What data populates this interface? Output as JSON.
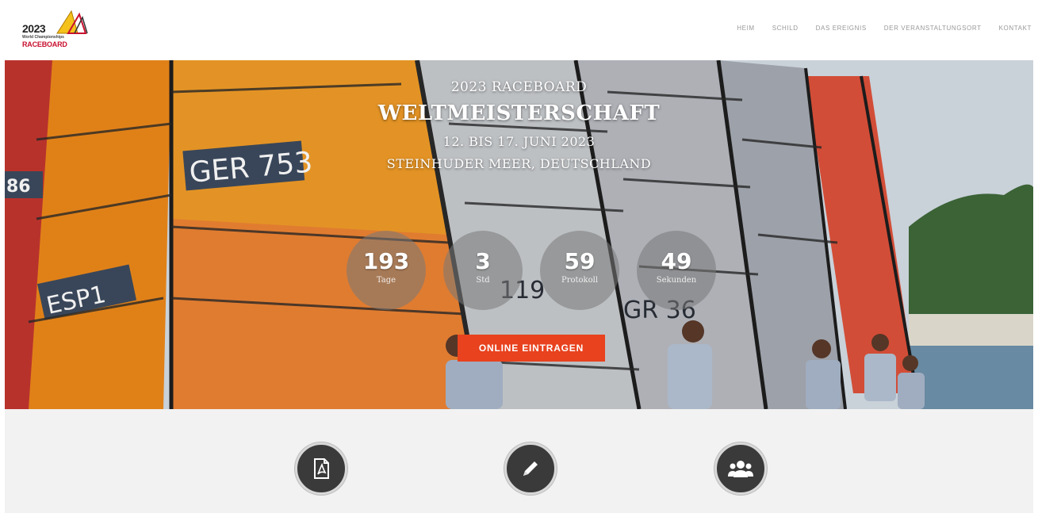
{
  "header": {
    "logo": {
      "year": "2023",
      "subtitle": "World Championships",
      "brand": "RACEBOARD"
    },
    "nav": [
      {
        "label": "HEIM"
      },
      {
        "label": "SCHILD"
      },
      {
        "label": "DAS EREIGNIS"
      },
      {
        "label": "DER VERANSTALTUNGSORT"
      },
      {
        "label": "KONTAKT"
      }
    ]
  },
  "hero": {
    "line1": "2023 RACEBOARD",
    "line2": "WELTMEISTERSCHAFT",
    "line3": "12. BIS 17. JUNI 2023",
    "line4": "STEINHUDER MEER, DEUTSCHLAND",
    "sail_numbers": [
      "86",
      "GER 753",
      "ESP1",
      "119",
      "GR 36"
    ],
    "countdown": [
      {
        "value": "193",
        "label": "Tage"
      },
      {
        "value": "3",
        "label": "Std"
      },
      {
        "value": "59",
        "label": "Protokoll"
      },
      {
        "value": "49",
        "label": "Sekunden"
      }
    ],
    "cta_label": "ONLINE EINTRAGEN"
  },
  "features": [
    {
      "icon": "pdf-document-icon"
    },
    {
      "icon": "pencil-icon"
    },
    {
      "icon": "users-group-icon"
    }
  ],
  "colors": {
    "cta": "#e8421e",
    "orange_sail": "#f08a1c",
    "feature_circle": "#3a3a3a"
  }
}
